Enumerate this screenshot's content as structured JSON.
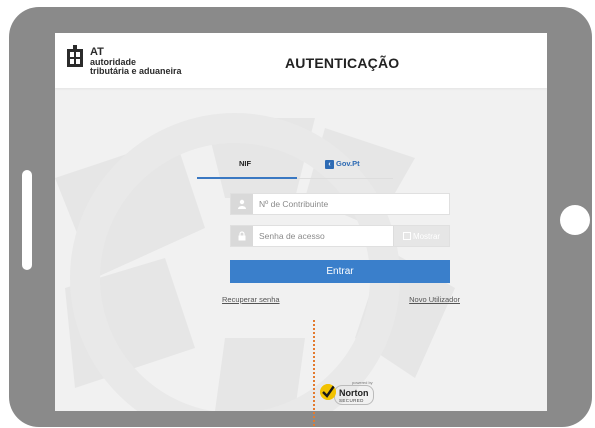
{
  "header": {
    "logo_abbr": "AT",
    "logo_line1": "autoridade",
    "logo_line2": "tributária e aduaneira",
    "title": "AUTENTICAÇÃO"
  },
  "tabs": [
    {
      "label": "NIF",
      "active": true
    },
    {
      "label": "Gov.Pt",
      "active": false
    }
  ],
  "form": {
    "nif_placeholder": "Nº de Contribuinte",
    "password_placeholder": "Senha de acesso",
    "show_label": "Mostrar",
    "submit_label": "Entrar"
  },
  "links": {
    "recover": "Recuperar senha",
    "new_user": "Novo Utilizador"
  },
  "badge": {
    "top": "powered by",
    "name": "Norton",
    "secured": "SECURED"
  },
  "colors": {
    "accent": "#3a7fcb",
    "bezel": "#8a8a8a",
    "annotation": "#e37a2e",
    "norton": "#f2c200"
  },
  "icons": [
    "user-icon",
    "lock-icon",
    "checkbox-icon",
    "norton-check-icon",
    "at-logo-icon"
  ]
}
